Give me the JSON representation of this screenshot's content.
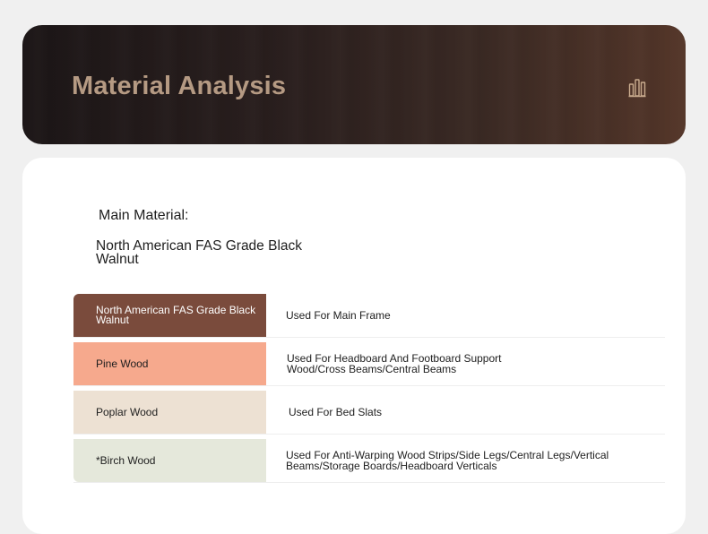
{
  "header": {
    "title": "Material Analysis",
    "icon": "building-columns-icon"
  },
  "main_material": {
    "label": "Main Material:",
    "value": "North American FAS Grade Black Walnut"
  },
  "materials": [
    {
      "name": "North American FAS Grade Black Walnut",
      "use": "Used For Main Frame",
      "color": "#7a4b3c",
      "text_color": "#ffffff"
    },
    {
      "name": "Pine Wood",
      "use": "Used For Headboard And Footboard Support Wood/Cross Beams/Central Beams",
      "color": "#f6a98d",
      "text_color": "#1e1e1e"
    },
    {
      "name": "Poplar Wood",
      "use": "Used For Bed Slats",
      "color": "#ede1d3",
      "text_color": "#1e1e1e"
    },
    {
      "name": "*Birch Wood",
      "use": "Used For Anti-Warping Wood Strips/Side Legs/Central Legs/Vertical Beams/Storage Boards/Headboard Verticals",
      "color": "#e5e8db",
      "text_color": "#1e1e1e"
    }
  ]
}
